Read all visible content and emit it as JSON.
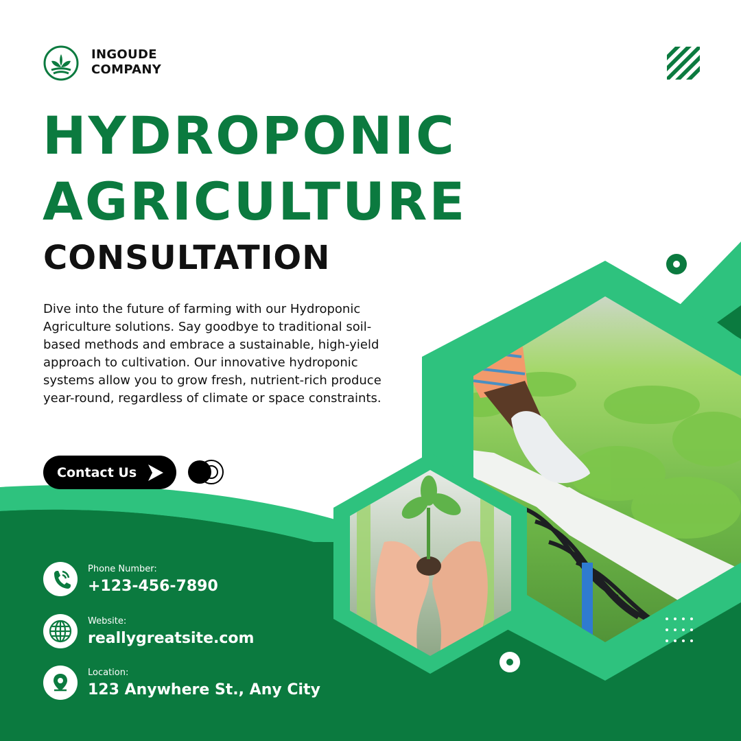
{
  "brand": {
    "name_line1": "INGOUDE",
    "name_line2": "COMPANY",
    "logo_icon": "leaf-in-circle-icon"
  },
  "headline": {
    "line1": "HYDROPONIC",
    "line2": "AGRICULTURE",
    "subtitle": "CONSULTATION"
  },
  "description": "Dive into the future of farming with our Hydroponic Agriculture solutions. Say goodbye to traditional soil-based methods and embrace a sustainable, high-yield approach to cultivation. Our innovative hydroponic systems allow you to grow fresh, nutrient-rich produce year-round, regardless of climate or space constraints.",
  "cta": {
    "label": "Contact Us",
    "icon": "play-arrow-icon"
  },
  "contact": {
    "phone_label": "Phone Number:",
    "phone_value": "+123-456-7890",
    "website_label": "Website:",
    "website_value": "reallygreatsite.com",
    "location_label": "Location:",
    "location_value": "123 Anywhere St., Any City"
  },
  "colors": {
    "primary_green": "#0b7a3f",
    "accent_green": "#2ec27e",
    "text_dark": "#111111",
    "white": "#ffffff"
  }
}
